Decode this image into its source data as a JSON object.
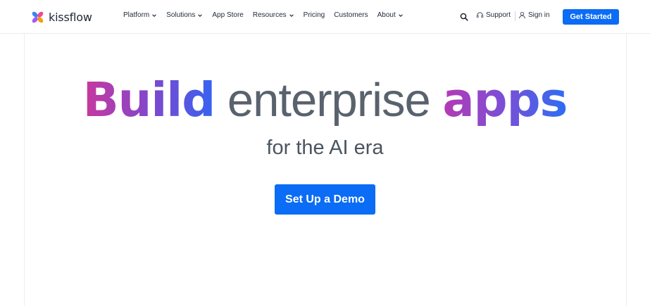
{
  "brand": {
    "name": "kissflow",
    "logo_colors": [
      "#3b82f6",
      "#ec4899",
      "#a855f7",
      "#f59e0b"
    ]
  },
  "nav": {
    "items": [
      {
        "label": "Platform",
        "has_dropdown": true
      },
      {
        "label": "Solutions",
        "has_dropdown": true
      },
      {
        "label": "App Store",
        "has_dropdown": false
      },
      {
        "label": "Resources",
        "has_dropdown": true
      },
      {
        "label": "Pricing",
        "has_dropdown": false
      },
      {
        "label": "Customers",
        "has_dropdown": false
      },
      {
        "label": "About",
        "has_dropdown": true
      }
    ],
    "support_label": "Support",
    "signin_label": "Sign in",
    "cta_label": "Get Started"
  },
  "hero": {
    "headline_part1": "Build",
    "headline_part2": " enterprise ",
    "headline_part3": "apps",
    "subheadline": "for the AI era",
    "cta_label": "Set Up a Demo"
  },
  "colors": {
    "primary": "#0b6cf5",
    "gradient_start": "#c8399d",
    "gradient_end": "#3463f2",
    "headline_gray": "#59626d"
  }
}
